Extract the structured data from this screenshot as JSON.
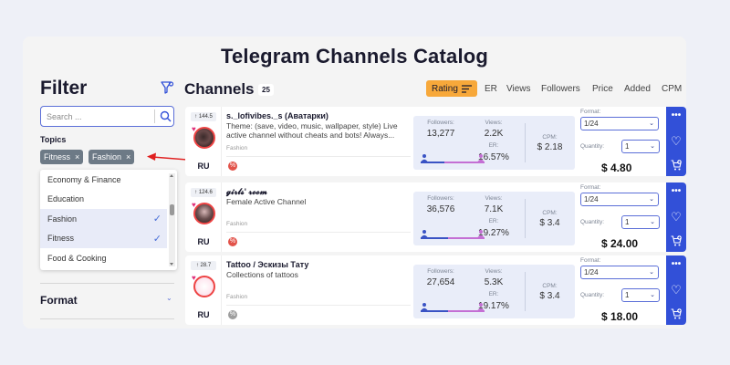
{
  "page_title": "Telegram Channels Catalog",
  "filter": {
    "title": "Filter",
    "search_placeholder": "Search ...",
    "topics_label": "Topics",
    "chips": [
      "Fitness",
      "Fashion"
    ],
    "chip_remove": "×",
    "topics_options": [
      {
        "label": "Economy & Finance",
        "selected": false
      },
      {
        "label": "Education",
        "selected": false
      },
      {
        "label": "Fashion",
        "selected": true
      },
      {
        "label": "Fitness",
        "selected": true
      },
      {
        "label": "Food & Cooking",
        "selected": false
      }
    ],
    "check_glyph": "✓",
    "format_label": "Format"
  },
  "channels": {
    "title": "Channels",
    "count": "25",
    "sort": {
      "active": "Rating",
      "options": [
        "ER",
        "Views",
        "Followers",
        "Price",
        "Added",
        "CPM"
      ]
    }
  },
  "labels": {
    "followers": "Followers:",
    "views": "Views:",
    "er": "ER:",
    "cpm": "CPM:",
    "format": "Format:",
    "quantity": "Quantity:"
  },
  "cards": [
    {
      "rating": "144.5",
      "name": "s._lofivibes._s (Аватарки)",
      "description": "Theme: (save, video, music, wallpaper, style) Live active channel without cheats and bots! Always...",
      "category": "Fashion",
      "country": "RU",
      "followers": "13,277",
      "views": "2.2K",
      "er": "16.57%",
      "er_fraction": 0.1657,
      "cpm": "$ 2.18",
      "format_value": "1/24",
      "quantity_value": "1",
      "price": "$ 4.80",
      "icon_color": "#e2534a"
    },
    {
      "rating": "124.6",
      "name": "𝓰𝓲𝓻𝓵𝓼' 𝓻𝓸𝓸𝓶",
      "description": "Female Active Channel",
      "category": "Fashion",
      "country": "RU",
      "followers": "36,576",
      "views": "7.1K",
      "er": "19.27%",
      "er_fraction": 0.1927,
      "cpm": "$ 3.4",
      "format_value": "1/24",
      "quantity_value": "1",
      "price": "$ 24.00",
      "icon_color": "#e2534a"
    },
    {
      "rating": "28.7",
      "name": "Tattoo / Эскизы Тату",
      "description": "Collections of tattoos",
      "category": "Fashion",
      "country": "RU",
      "followers": "27,654",
      "views": "5.3K",
      "er": "19.17%",
      "er_fraction": 0.1917,
      "cpm": "$ 3.4",
      "format_value": "1/24",
      "quantity_value": "1",
      "price": "$ 18.00",
      "icon_color": "#9e9e9e"
    }
  ],
  "colors": {
    "accent": "#3250d8",
    "sort_active": "#f7a83a",
    "arrow": "#e02020"
  }
}
